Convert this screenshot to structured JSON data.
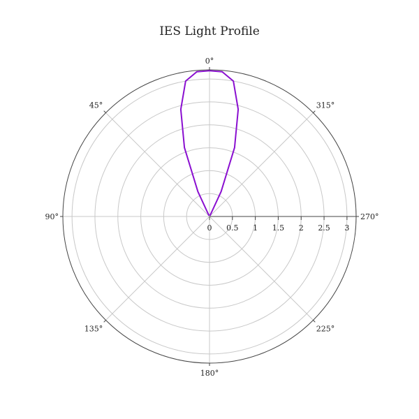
{
  "chart_data": {
    "type": "line",
    "subtype": "polar",
    "title": "IES Light Profile",
    "angular_axis": {
      "direction": "counterclockwise",
      "zero_at": "top",
      "tick_labels": [
        "0°",
        "45°",
        "90°",
        "135°",
        "180°",
        "225°",
        "270°",
        "315°"
      ],
      "tick_values": [
        0,
        45,
        90,
        135,
        180,
        225,
        270,
        315
      ]
    },
    "radial_axis": {
      "range": [
        0,
        3.2
      ],
      "tick_values": [
        0,
        0.5,
        1,
        1.5,
        2,
        2.5,
        3
      ],
      "tick_labels": [
        "0",
        "0.5",
        "1",
        "1.5",
        "2",
        "2.5",
        "3"
      ],
      "label_angle_deg": 270
    },
    "grid": true,
    "legend": false,
    "series": [
      {
        "color": "#8a0fd0",
        "theta": [
          330,
          335,
          340,
          345,
          350,
          355,
          0,
          5,
          10,
          15,
          20,
          25,
          30
        ],
        "r": [
          0.02,
          0.6,
          1.6,
          2.42,
          3.0,
          3.17,
          3.18,
          3.17,
          3.0,
          2.42,
          1.6,
          0.6,
          0.02
        ]
      }
    ]
  }
}
